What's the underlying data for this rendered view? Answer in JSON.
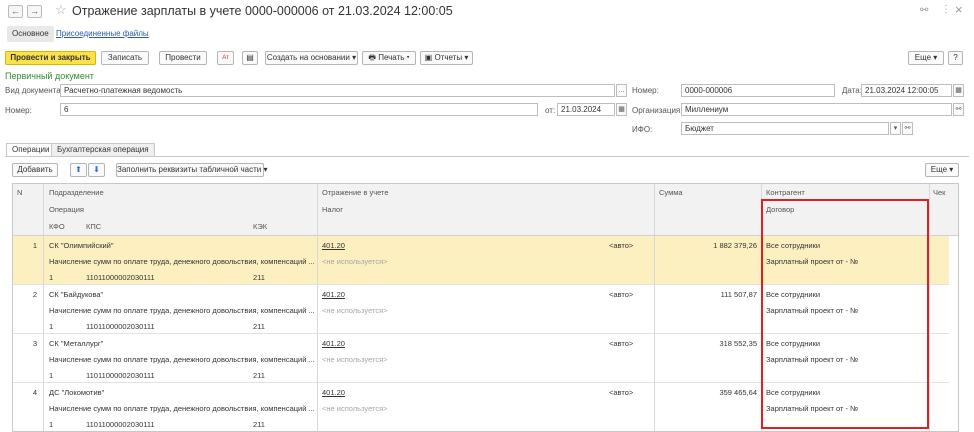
{
  "window": {
    "title": "Отражение зарплаты в учете 0000-000006 от 21.03.2024 12:00:05",
    "nav_back": "←",
    "nav_forward": "→",
    "link_icon": "link-icon",
    "more_icon": "⋮",
    "close_icon": "×"
  },
  "top_tabs": {
    "main": "Основное",
    "files": "Присоединенные файлы"
  },
  "toolbar": {
    "post_close": "Провести и закрыть",
    "save": "Записать",
    "post": "Провести",
    "dt_kt": "Дт Кт",
    "create_based": "Создать на основании ▾",
    "print": "Печать ▾",
    "reports": "Отчеты ▾",
    "more": "Еще ▾",
    "help": "?"
  },
  "section_title": "Первичный документ",
  "form": {
    "doc_type_label": "Вид документа:",
    "doc_type_value": "Расчетно-платежная ведомость",
    "number_label_left": "Номер:",
    "number_value_left": "6",
    "from_label": "от:",
    "from_date": "21.03.2024",
    "number_label_right": "Номер:",
    "number_value_right": "0000-000006",
    "date_label": "Дата:",
    "date_value": "21.03.2024 12:00:05",
    "org_label": "Организация:",
    "org_value": "Миллениум",
    "ifo_label": "ИФО:",
    "ifo_value": "Бюджет"
  },
  "inner_tabs": {
    "operations": "Операции",
    "accounting": "Бухгалтерская операция"
  },
  "table_toolbar": {
    "add": "Добавить",
    "up": "⬆",
    "down": "⬇",
    "fill": "Заполнить реквизиты табличной части ▾",
    "more": "Еще ▾"
  },
  "table_header": {
    "n": "N",
    "division": "Подразделение",
    "operation": "Операция",
    "kfo": "КФО",
    "kps": "КПС",
    "kek": "КЭК",
    "reflection": "Отражение в учете",
    "tax": "Налог",
    "sum": "Сумма",
    "counterparty": "Контрагент",
    "contract": "Договор",
    "check": "Чек"
  },
  "rows": [
    {
      "n": "1",
      "division": "СК \"Олимпийский\"",
      "account": "401.20",
      "auto": "<авто>",
      "sum": "1 882 379,26",
      "counterparty": "Все сотрудники",
      "operation": "Начисление сумм по оплате труда, денежного довольствия, компенсаций ...",
      "tax": "<не используется>",
      "contract": "Зарплатный проект от - №",
      "kfo": "1",
      "kps": "11011000002030111",
      "kek": "211"
    },
    {
      "n": "2",
      "division": "СК \"Байдукова\"",
      "account": "401.20",
      "auto": "<авто>",
      "sum": "111 507,87",
      "counterparty": "Все сотрудники",
      "operation": "Начисление сумм по оплате труда, денежного довольствия, компенсаций ...",
      "tax": "<не используется>",
      "contract": "Зарплатный проект от - №",
      "kfo": "1",
      "kps": "11011000002030111",
      "kek": "211"
    },
    {
      "n": "3",
      "division": "СК \"Металлург\"",
      "account": "401.20",
      "auto": "<авто>",
      "sum": "318 552,35",
      "counterparty": "Все сотрудники",
      "operation": "Начисление сумм по оплате труда, денежного довольствия, компенсаций ...",
      "tax": "<не используется>",
      "contract": "Зарплатный проект от - №",
      "kfo": "1",
      "kps": "11011000002030111",
      "kek": "211"
    },
    {
      "n": "4",
      "division": "ДС \"Локомотив\"",
      "account": "401.20",
      "auto": "<авто>",
      "sum": "359 465,64",
      "counterparty": "Все сотрудники",
      "operation": "Начисление сумм по оплате труда, денежного довольствия, компенсаций ...",
      "tax": "<не используется>",
      "contract": "Зарплатный проект от - №",
      "kfo": "1",
      "kps": "11011000002030111",
      "kek": "211"
    }
  ]
}
